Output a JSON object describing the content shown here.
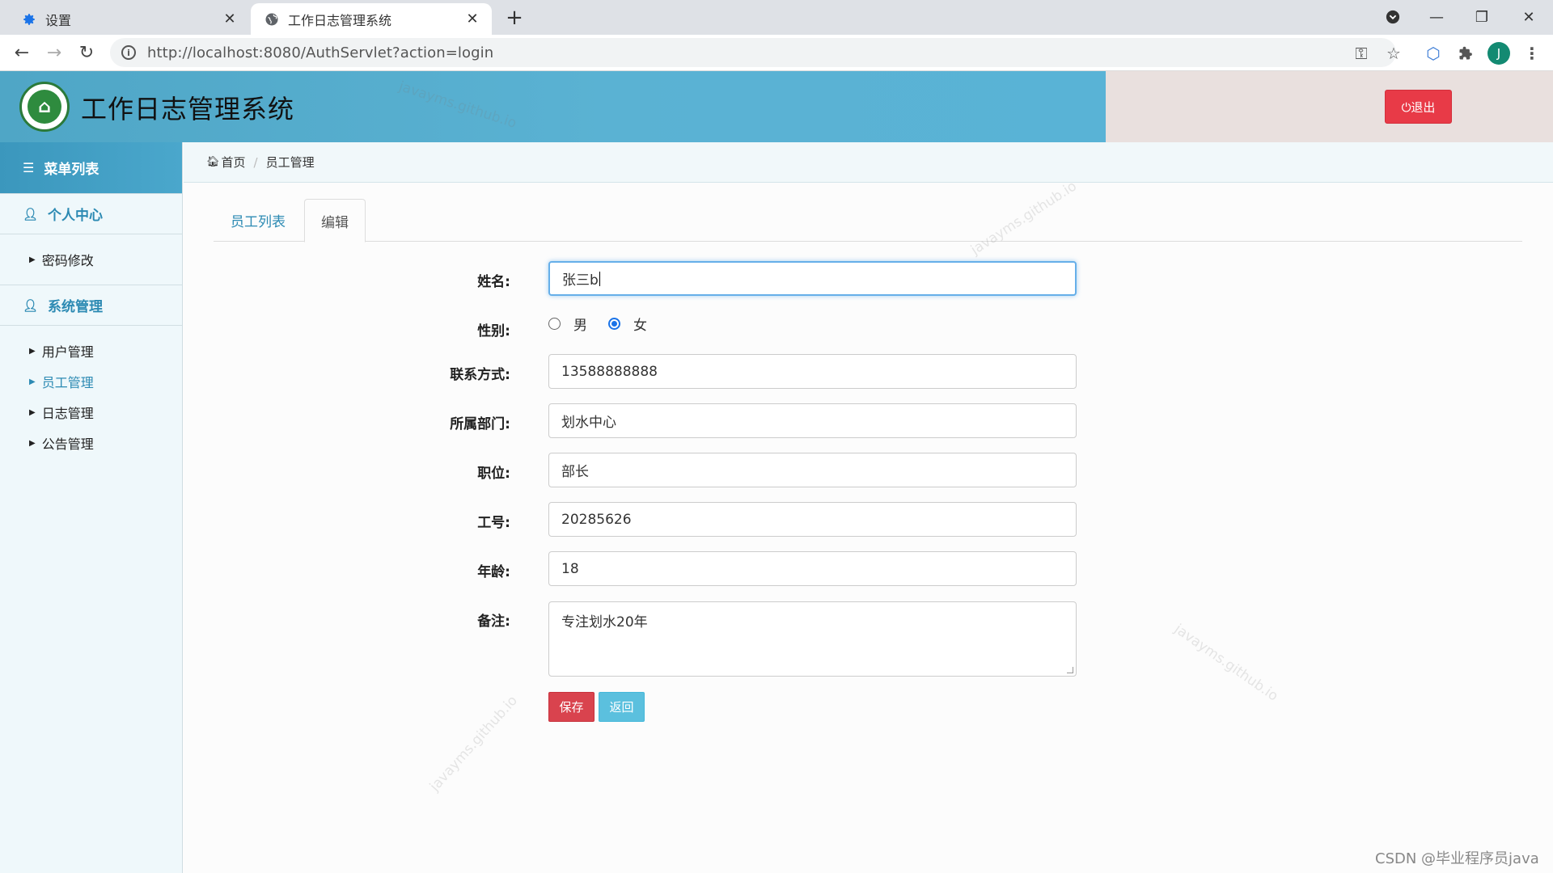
{
  "browser": {
    "tabs": [
      {
        "label": "设置",
        "icon": "gear-icon",
        "active": false
      },
      {
        "label": "工作日志管理系统",
        "icon": "globe-icon",
        "active": true
      }
    ],
    "url": "http://localhost:8080/AuthServlet?action=login",
    "profile_initial": "J"
  },
  "header": {
    "title": "工作日志管理系统",
    "logout_label": "⏻退出"
  },
  "sidebar": {
    "title": "菜单列表",
    "groups": [
      {
        "label": "个人中心",
        "items": [
          {
            "label": "密码修改",
            "active": false
          }
        ]
      },
      {
        "label": "系统管理",
        "items": [
          {
            "label": "用户管理",
            "active": false
          },
          {
            "label": "员工管理",
            "active": true
          },
          {
            "label": "日志管理",
            "active": false
          },
          {
            "label": "公告管理",
            "active": false
          }
        ]
      }
    ]
  },
  "breadcrumb": {
    "home": "首页",
    "current": "员工管理"
  },
  "tabs": {
    "list": "员工列表",
    "edit": "编辑"
  },
  "form": {
    "name": {
      "label": "姓名:",
      "value": "张三b"
    },
    "gender": {
      "label": "性别:",
      "options": [
        "男",
        "女"
      ],
      "selected": "女"
    },
    "contact": {
      "label": "联系方式:",
      "value": "13588888888"
    },
    "department": {
      "label": "所属部门:",
      "value": "划水中心"
    },
    "position": {
      "label": "职位:",
      "value": "部长"
    },
    "employee_id": {
      "label": "工号:",
      "value": "20285626"
    },
    "age": {
      "label": "年龄:",
      "value": "18"
    },
    "remarks": {
      "label": "备注:",
      "value": "专注划水20年"
    },
    "save_label": "保存",
    "back_label": "返回"
  },
  "watermark_text": "javayms.github.io",
  "footer_credit": "CSDN @毕业程序员java",
  "colors": {
    "header_blue": "#5ab2d3",
    "accent": "#2c8ab3",
    "danger": "#e83a47",
    "info": "#5bc0de"
  }
}
